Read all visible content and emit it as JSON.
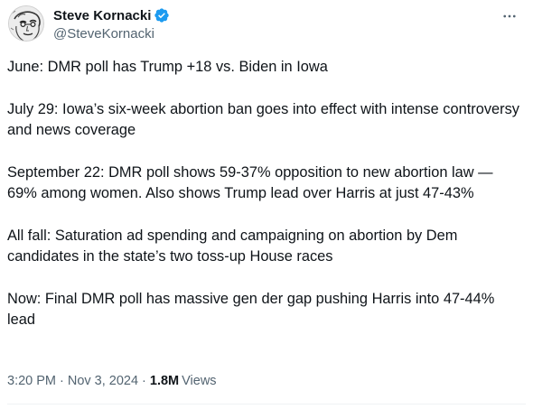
{
  "author": {
    "display_name": "Steve Kornacki",
    "handle": "@SteveKornacki",
    "verified_icon": "verified-badge-icon",
    "avatar_icon": "avatar-sketch"
  },
  "menu": {
    "more_icon": "more-horizontal-icon"
  },
  "tweet": {
    "paragraphs": [
      "June: DMR poll has Trump +18 vs. Biden in Iowa",
      "July 29: Iowa’s six-week abortion ban goes into effect with intense controversy and news coverage",
      "September 22: DMR poll shows 59-37% opposition to new abortion law — 69% among women. Also shows Trump lead over Harris at just 47-43%",
      "All fall: Saturation ad spending and campaigning on abortion by Dem candidates in the state’s two toss-up House races",
      "Now: Final DMR poll has massive gen der gap pushing Harris into 47-44% lead"
    ],
    "time": "3:20 PM",
    "separator": "·",
    "date": "Nov 3, 2024",
    "views_count": "1.8M",
    "views_label": "Views"
  },
  "colors": {
    "text_primary": "#0f1419",
    "text_secondary": "#536471",
    "verified_blue": "#1d9bf0",
    "divider": "#eff3f4"
  }
}
